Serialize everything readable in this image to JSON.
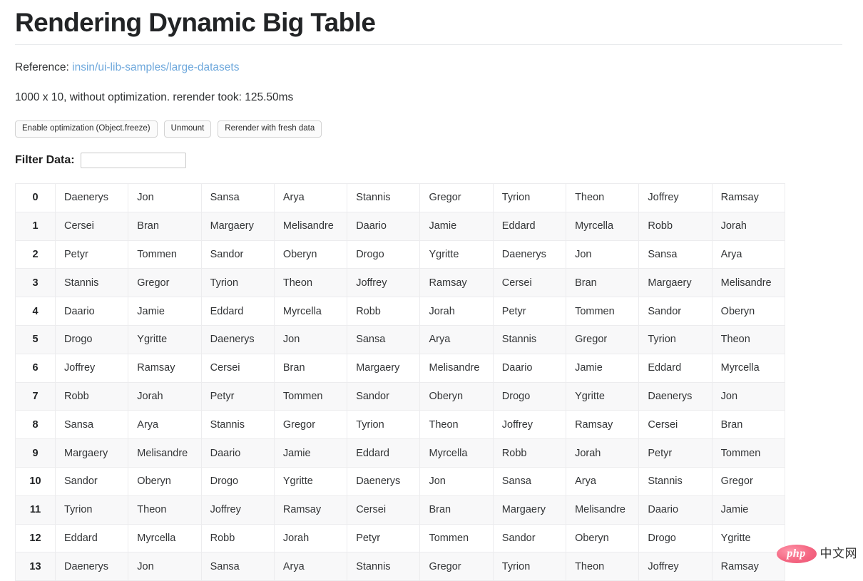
{
  "header": {
    "title": "Rendering Dynamic Big Table"
  },
  "reference": {
    "label": "Reference:",
    "link_text": "insin/ui-lib-samples/large-datasets"
  },
  "status": {
    "text": "1000 x 10, without optimization. rerender took: 125.50ms"
  },
  "buttons": [
    {
      "label": "Enable optimization (Object.freeze)",
      "name": "enable-optimization-button"
    },
    {
      "label": "Unmount",
      "name": "unmount-button"
    },
    {
      "label": "Rerender with fresh data",
      "name": "rerender-button"
    }
  ],
  "filter": {
    "label": "Filter Data:",
    "value": "",
    "placeholder": ""
  },
  "colors": {
    "link": "#6ea8dc",
    "row_alt": "#f8f8f9",
    "border": "#ececee",
    "watermark_badge": "#ee4f70"
  },
  "table": {
    "row_count_visible": 14,
    "column_count": 10,
    "rows": [
      {
        "index": "0",
        "cells": [
          "Daenerys",
          "Jon",
          "Sansa",
          "Arya",
          "Stannis",
          "Gregor",
          "Tyrion",
          "Theon",
          "Joffrey",
          "Ramsay"
        ]
      },
      {
        "index": "1",
        "cells": [
          "Cersei",
          "Bran",
          "Margaery",
          "Melisandre",
          "Daario",
          "Jamie",
          "Eddard",
          "Myrcella",
          "Robb",
          "Jorah"
        ]
      },
      {
        "index": "2",
        "cells": [
          "Petyr",
          "Tommen",
          "Sandor",
          "Oberyn",
          "Drogo",
          "Ygritte",
          "Daenerys",
          "Jon",
          "Sansa",
          "Arya"
        ]
      },
      {
        "index": "3",
        "cells": [
          "Stannis",
          "Gregor",
          "Tyrion",
          "Theon",
          "Joffrey",
          "Ramsay",
          "Cersei",
          "Bran",
          "Margaery",
          "Melisandre"
        ]
      },
      {
        "index": "4",
        "cells": [
          "Daario",
          "Jamie",
          "Eddard",
          "Myrcella",
          "Robb",
          "Jorah",
          "Petyr",
          "Tommen",
          "Sandor",
          "Oberyn"
        ]
      },
      {
        "index": "5",
        "cells": [
          "Drogo",
          "Ygritte",
          "Daenerys",
          "Jon",
          "Sansa",
          "Arya",
          "Stannis",
          "Gregor",
          "Tyrion",
          "Theon"
        ]
      },
      {
        "index": "6",
        "cells": [
          "Joffrey",
          "Ramsay",
          "Cersei",
          "Bran",
          "Margaery",
          "Melisandre",
          "Daario",
          "Jamie",
          "Eddard",
          "Myrcella"
        ]
      },
      {
        "index": "7",
        "cells": [
          "Robb",
          "Jorah",
          "Petyr",
          "Tommen",
          "Sandor",
          "Oberyn",
          "Drogo",
          "Ygritte",
          "Daenerys",
          "Jon"
        ]
      },
      {
        "index": "8",
        "cells": [
          "Sansa",
          "Arya",
          "Stannis",
          "Gregor",
          "Tyrion",
          "Theon",
          "Joffrey",
          "Ramsay",
          "Cersei",
          "Bran"
        ]
      },
      {
        "index": "9",
        "cells": [
          "Margaery",
          "Melisandre",
          "Daario",
          "Jamie",
          "Eddard",
          "Myrcella",
          "Robb",
          "Jorah",
          "Petyr",
          "Tommen"
        ]
      },
      {
        "index": "10",
        "cells": [
          "Sandor",
          "Oberyn",
          "Drogo",
          "Ygritte",
          "Daenerys",
          "Jon",
          "Sansa",
          "Arya",
          "Stannis",
          "Gregor"
        ]
      },
      {
        "index": "11",
        "cells": [
          "Tyrion",
          "Theon",
          "Joffrey",
          "Ramsay",
          "Cersei",
          "Bran",
          "Margaery",
          "Melisandre",
          "Daario",
          "Jamie"
        ]
      },
      {
        "index": "12",
        "cells": [
          "Eddard",
          "Myrcella",
          "Robb",
          "Jorah",
          "Petyr",
          "Tommen",
          "Sandor",
          "Oberyn",
          "Drogo",
          "Ygritte"
        ]
      },
      {
        "index": "13",
        "cells": [
          "Daenerys",
          "Jon",
          "Sansa",
          "Arya",
          "Stannis",
          "Gregor",
          "Tyrion",
          "Theon",
          "Joffrey",
          "Ramsay"
        ]
      }
    ]
  },
  "watermark": {
    "badge_text": "php",
    "site_text": "中文网"
  }
}
